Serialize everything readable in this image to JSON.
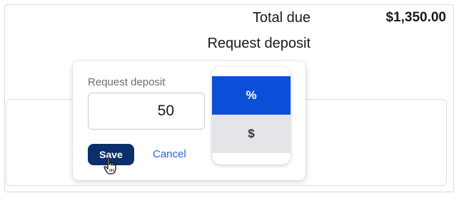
{
  "summary": {
    "total_label": "Total due",
    "total_value": "$1,350.00",
    "deposit_label": "Request deposit"
  },
  "popover": {
    "label": "Request deposit",
    "amount_value": "50",
    "save_label": "Save",
    "cancel_label": "Cancel"
  },
  "unit_toggle": {
    "options": [
      {
        "label": "%",
        "selected": true
      },
      {
        "label": "$",
        "selected": false
      }
    ]
  },
  "colors": {
    "save_button": "#0b2f6b",
    "selected_option": "#0b4fd8",
    "unselected_option": "#e4e5e8",
    "link": "#2e63d6"
  },
  "cursor": "hand-pointer-icon"
}
